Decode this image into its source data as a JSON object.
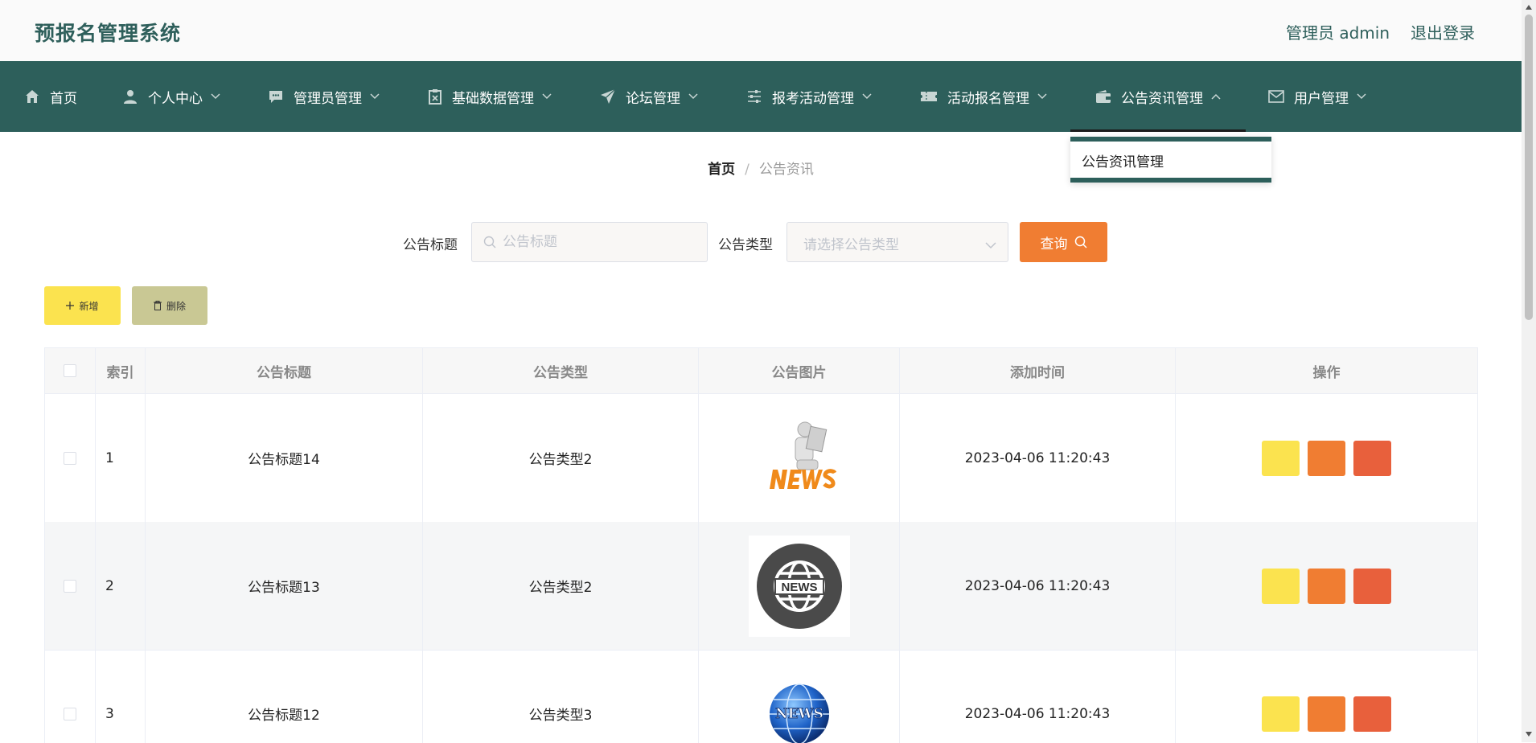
{
  "app": {
    "title": "预报名管理系统"
  },
  "header": {
    "admin_label": "管理员 admin",
    "logout_label": "退出登录"
  },
  "nav": {
    "items": [
      {
        "label": "首页",
        "icon": "home-icon"
      },
      {
        "label": "个人中心",
        "icon": "user-icon"
      },
      {
        "label": "管理员管理",
        "icon": "chat-icon"
      },
      {
        "label": "基础数据管理",
        "icon": "clipboard-icon"
      },
      {
        "label": "论坛管理",
        "icon": "send-icon"
      },
      {
        "label": "报考活动管理",
        "icon": "sliders-icon"
      },
      {
        "label": "活动报名管理",
        "icon": "ticket-icon"
      },
      {
        "label": "公告资讯管理",
        "icon": "wallet-icon"
      },
      {
        "label": "用户管理",
        "icon": "mail-icon"
      }
    ],
    "dropdown": {
      "item": "公告资讯管理"
    }
  },
  "breadcrumb": {
    "home": "首页",
    "separator": "/",
    "current": "公告资讯"
  },
  "search": {
    "title_label": "公告标题",
    "title_placeholder": "公告标题",
    "type_label": "公告类型",
    "type_placeholder": "请选择公告类型",
    "query_label": "查询"
  },
  "actions": {
    "add_label": "新增",
    "delete_label": "删除"
  },
  "table": {
    "columns": [
      "索引",
      "公告标题",
      "公告类型",
      "公告图片",
      "添加时间",
      "操作"
    ],
    "rows": [
      {
        "index": "1",
        "title": "公告标题14",
        "type": "公告类型2",
        "image": "news-person-image",
        "time": "2023-04-06 11:20:43"
      },
      {
        "index": "2",
        "title": "公告标题13",
        "type": "公告类型2",
        "image": "news-globe-dark-image",
        "time": "2023-04-06 11:20:43"
      },
      {
        "index": "3",
        "title": "公告标题12",
        "type": "公告类型3",
        "image": "news-globe-blue-image",
        "time": "2023-04-06 11:20:43"
      }
    ]
  },
  "colors": {
    "primary": "#2d5f5b",
    "query": "#f07d32",
    "add": "#fbe34f",
    "delete": "#c9c894",
    "danger": "#e8603c"
  }
}
